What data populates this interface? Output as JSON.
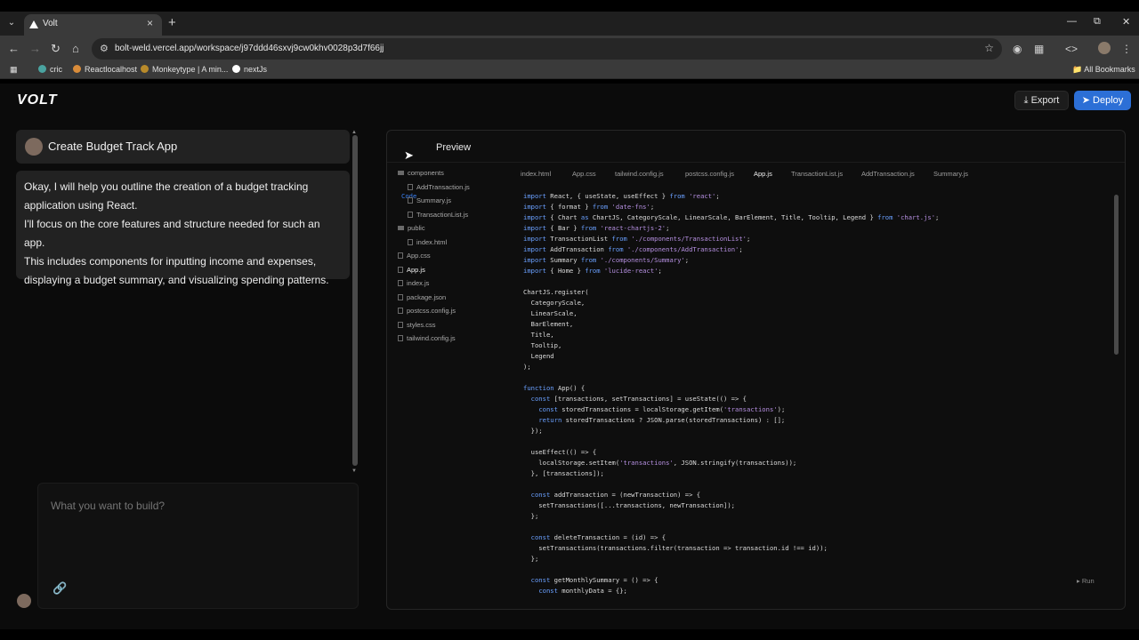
{
  "browser": {
    "tab_title": "Volt",
    "url": "bolt-weld.vercel.app/workspace/j97ddd46sxvj9cw0khv0028p3d7f66jj",
    "bookmarks": [
      "cric",
      "Reactlocalhost",
      "Monkeytype | A min...",
      "nextJs"
    ],
    "all_bookmarks": "All Bookmarks"
  },
  "app": {
    "logo": "VOLT",
    "export_label": "Export",
    "deploy_label": "Deploy"
  },
  "chat": {
    "title": "Create Budget Track App",
    "message_lines": [
      "Okay, I will help you outline the creation of a budget tracking",
      "application using React.",
      "I'll focus on the core features and structure needed for such an app.",
      "This includes components for inputting income and expenses,",
      "displaying a budget summary, and visualizing spending patterns."
    ],
    "input_placeholder": "What you want to build?"
  },
  "workbench": {
    "tab_code": "Code",
    "tab_preview": "Preview",
    "file_tree": [
      {
        "name": "components",
        "type": "folder",
        "depth": 0
      },
      {
        "name": "AddTransaction.js",
        "type": "file",
        "depth": 1
      },
      {
        "name": "Summary.js",
        "type": "file",
        "depth": 1
      },
      {
        "name": "TransactionList.js",
        "type": "file",
        "depth": 1
      },
      {
        "name": "public",
        "type": "folder",
        "depth": 0
      },
      {
        "name": "index.html",
        "type": "file",
        "depth": 1
      },
      {
        "name": "App.css",
        "type": "file",
        "depth": 0
      },
      {
        "name": "App.js",
        "type": "file",
        "depth": 0,
        "active": true
      },
      {
        "name": "index.js",
        "type": "file",
        "depth": 0
      },
      {
        "name": "package.json",
        "type": "file",
        "depth": 0
      },
      {
        "name": "postcss.config.js",
        "type": "file",
        "depth": 0
      },
      {
        "name": "styles.css",
        "type": "file",
        "depth": 0
      },
      {
        "name": "tailwind.config.js",
        "type": "file",
        "depth": 0
      }
    ],
    "file_tabs": [
      "index.html",
      "App.css",
      "tailwind.config.js",
      "postcss.config.js",
      "App.js",
      "TransactionList.js",
      "AddTransaction.js",
      "Summary.js"
    ],
    "active_file_tab": "App.js",
    "run_label": "Run",
    "code_lines": [
      "import React, { useState, useEffect } from 'react';",
      "import { format } from 'date-fns';",
      "import { Chart as ChartJS, CategoryScale, LinearScale, BarElement, Title, Tooltip, Legend } from 'chart.js';",
      "import { Bar } from 'react-chartjs-2';",
      "import TransactionList from './components/TransactionList';",
      "import AddTransaction from './components/AddTransaction';",
      "import Summary from './components/Summary';",
      "import { Home } from 'lucide-react';",
      "",
      "ChartJS.register(",
      "  CategoryScale,",
      "  LinearScale,",
      "  BarElement,",
      "  Title,",
      "  Tooltip,",
      "  Legend",
      ");",
      "",
      "function App() {",
      "  const [transactions, setTransactions] = useState(() => {",
      "    const storedTransactions = localStorage.getItem('transactions');",
      "    return storedTransactions ? JSON.parse(storedTransactions) : [];",
      "  });",
      "",
      "  useEffect(() => {",
      "    localStorage.setItem('transactions', JSON.stringify(transactions));",
      "  }, [transactions]);",
      "",
      "  const addTransaction = (newTransaction) => {",
      "    setTransactions([...transactions, newTransaction]);",
      "  };",
      "",
      "  const deleteTransaction = (id) => {",
      "    setTransactions(transactions.filter(transaction => transaction.id !== id));",
      "  };",
      "",
      "  const getMonthlySummary = () => {",
      "    const monthlyData = {};"
    ]
  }
}
